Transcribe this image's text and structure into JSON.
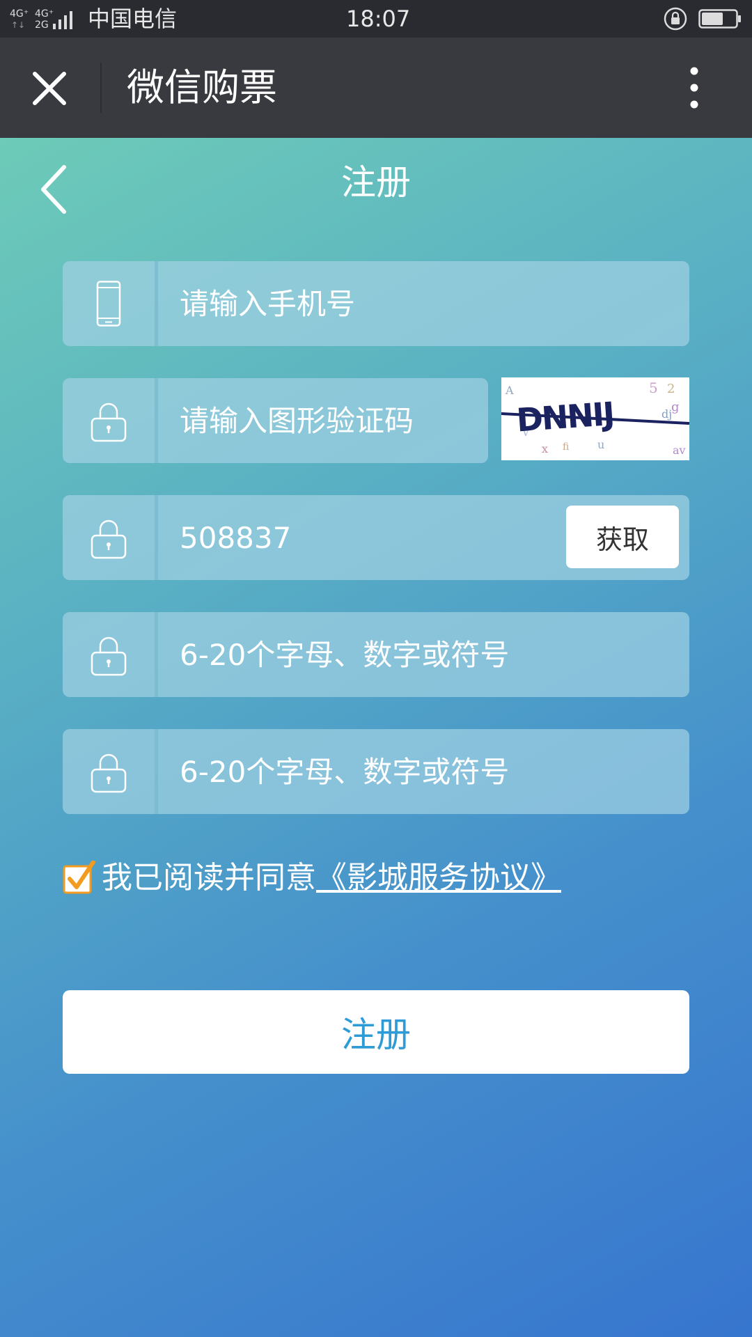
{
  "status_bar": {
    "network": "4G⁺ 4G⁺ 2G",
    "carrier": "中国电信",
    "time": "18:07"
  },
  "nav": {
    "title": "微信购票",
    "close_icon": "close-icon",
    "more_icon": "more-vertical-icon"
  },
  "page": {
    "title": "注册",
    "back_icon": "chevron-left-icon"
  },
  "form": {
    "phone_placeholder": "请输入手机号",
    "captcha_placeholder": "请输入图形验证码",
    "captcha_image_text": "DNNIJ",
    "sms_code_value": "508837",
    "get_code_label": "获取",
    "password_placeholder": "6-20个字母、数字或符号",
    "confirm_password_placeholder": "6-20个字母、数字或符号"
  },
  "agreement": {
    "checked": true,
    "text": "我已阅读并同意",
    "link": "《影城服务协议》"
  },
  "register_button": "注册",
  "colors": {
    "nav_bg": "#393a3f",
    "gradient_start": "#6dcbb8",
    "gradient_end": "#3775ce",
    "checkbox_accent": "#f29b1e",
    "button_text": "#2f9bd6"
  }
}
